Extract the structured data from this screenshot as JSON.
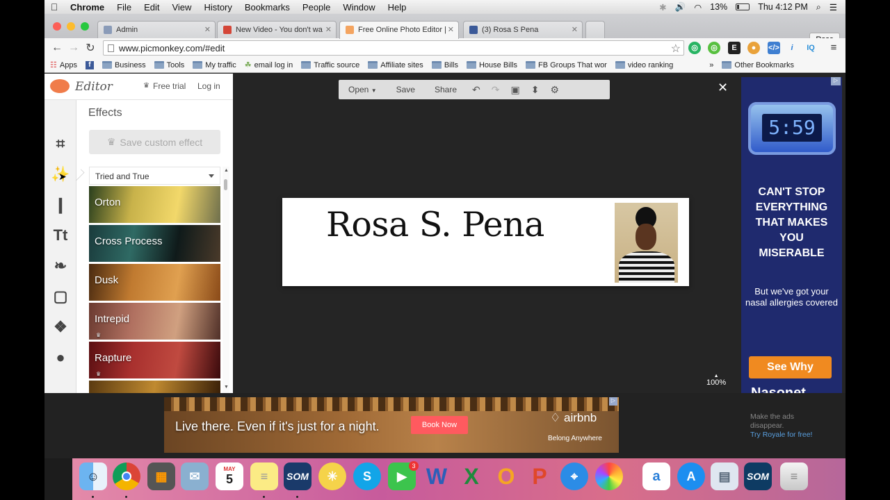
{
  "menubar": {
    "app_name": "Chrome",
    "items": [
      "File",
      "Edit",
      "View",
      "History",
      "Bookmarks",
      "People",
      "Window",
      "Help"
    ],
    "battery": "13%",
    "clock": "Thu 4:12 PM"
  },
  "tabs": [
    {
      "label": "Admin",
      "favicon_color": "#8a9bb8"
    },
    {
      "label": "New Video - You don't wa",
      "favicon_color": "#d44638"
    },
    {
      "label": "Free Online Photo Editor |",
      "favicon_color": "#f4a460"
    },
    {
      "label": "(3) Rosa S Pena",
      "favicon_color": "#3b5998"
    }
  ],
  "active_tab_index": 2,
  "profile_name": "Rosa",
  "address": {
    "url": "www.picmonkey.com/#edit"
  },
  "bookmarks": {
    "items": [
      "Apps",
      "Business",
      "Tools",
      "My traffic",
      "email log in",
      "Traffic source",
      "Affiliate sites",
      "Bills",
      "House Bills",
      "FB Groups That wor",
      "video ranking"
    ],
    "overflow": "»",
    "other": "Other Bookmarks"
  },
  "editor": {
    "logo_text": "Editor",
    "free_trial": "Free trial",
    "login": "Log in",
    "panel_title": "Effects",
    "save_custom": "Save custom effect",
    "category": "Tried and True",
    "effects": [
      {
        "label": "Orton",
        "premium": false,
        "colors": [
          "#2a3f1d",
          "#c8b24a",
          "#f2d86a",
          "#6f6f4c"
        ]
      },
      {
        "label": "Cross Process",
        "premium": false,
        "colors": [
          "#1a3b3c",
          "#2f6a64",
          "#0f1a1a",
          "#4a3a2a"
        ]
      },
      {
        "label": "Dusk",
        "premium": false,
        "colors": [
          "#4a2a10",
          "#c07a30",
          "#e0a050",
          "#8a4a18"
        ]
      },
      {
        "label": "Intrepid",
        "premium": true,
        "colors": [
          "#6a3a30",
          "#b07060",
          "#d0a080",
          "#503028"
        ]
      },
      {
        "label": "Rapture",
        "premium": true,
        "colors": [
          "#5a0f12",
          "#a8302e",
          "#c04a40",
          "#3a0a0c"
        ]
      }
    ],
    "toolbar": {
      "open": "Open",
      "save": "Save",
      "share": "Share"
    },
    "zoom": "100%",
    "canvas_name": "Rosa S. Pena"
  },
  "right_ad": {
    "clock_digits": "5:59",
    "headline": "CAN'T STOP EVERYTHING THAT MAKES YOU MISERABLE",
    "sub": "But we've got your nasal allergies covered",
    "button": "See Why",
    "cut_text": "Nasonet"
  },
  "bottom_ad": {
    "text": "Live there. Even if it's just for a night.",
    "button": "Book Now",
    "brand": "airbnb",
    "tagline": "Belong Anywhere"
  },
  "royale": {
    "line1": "Make the ads",
    "line2": "disappear.",
    "link": "Try Royale for free!"
  },
  "dock": {
    "calendar_month": "MAY",
    "calendar_day": "5",
    "facetime_badge": "3",
    "som_label": "SOM"
  }
}
